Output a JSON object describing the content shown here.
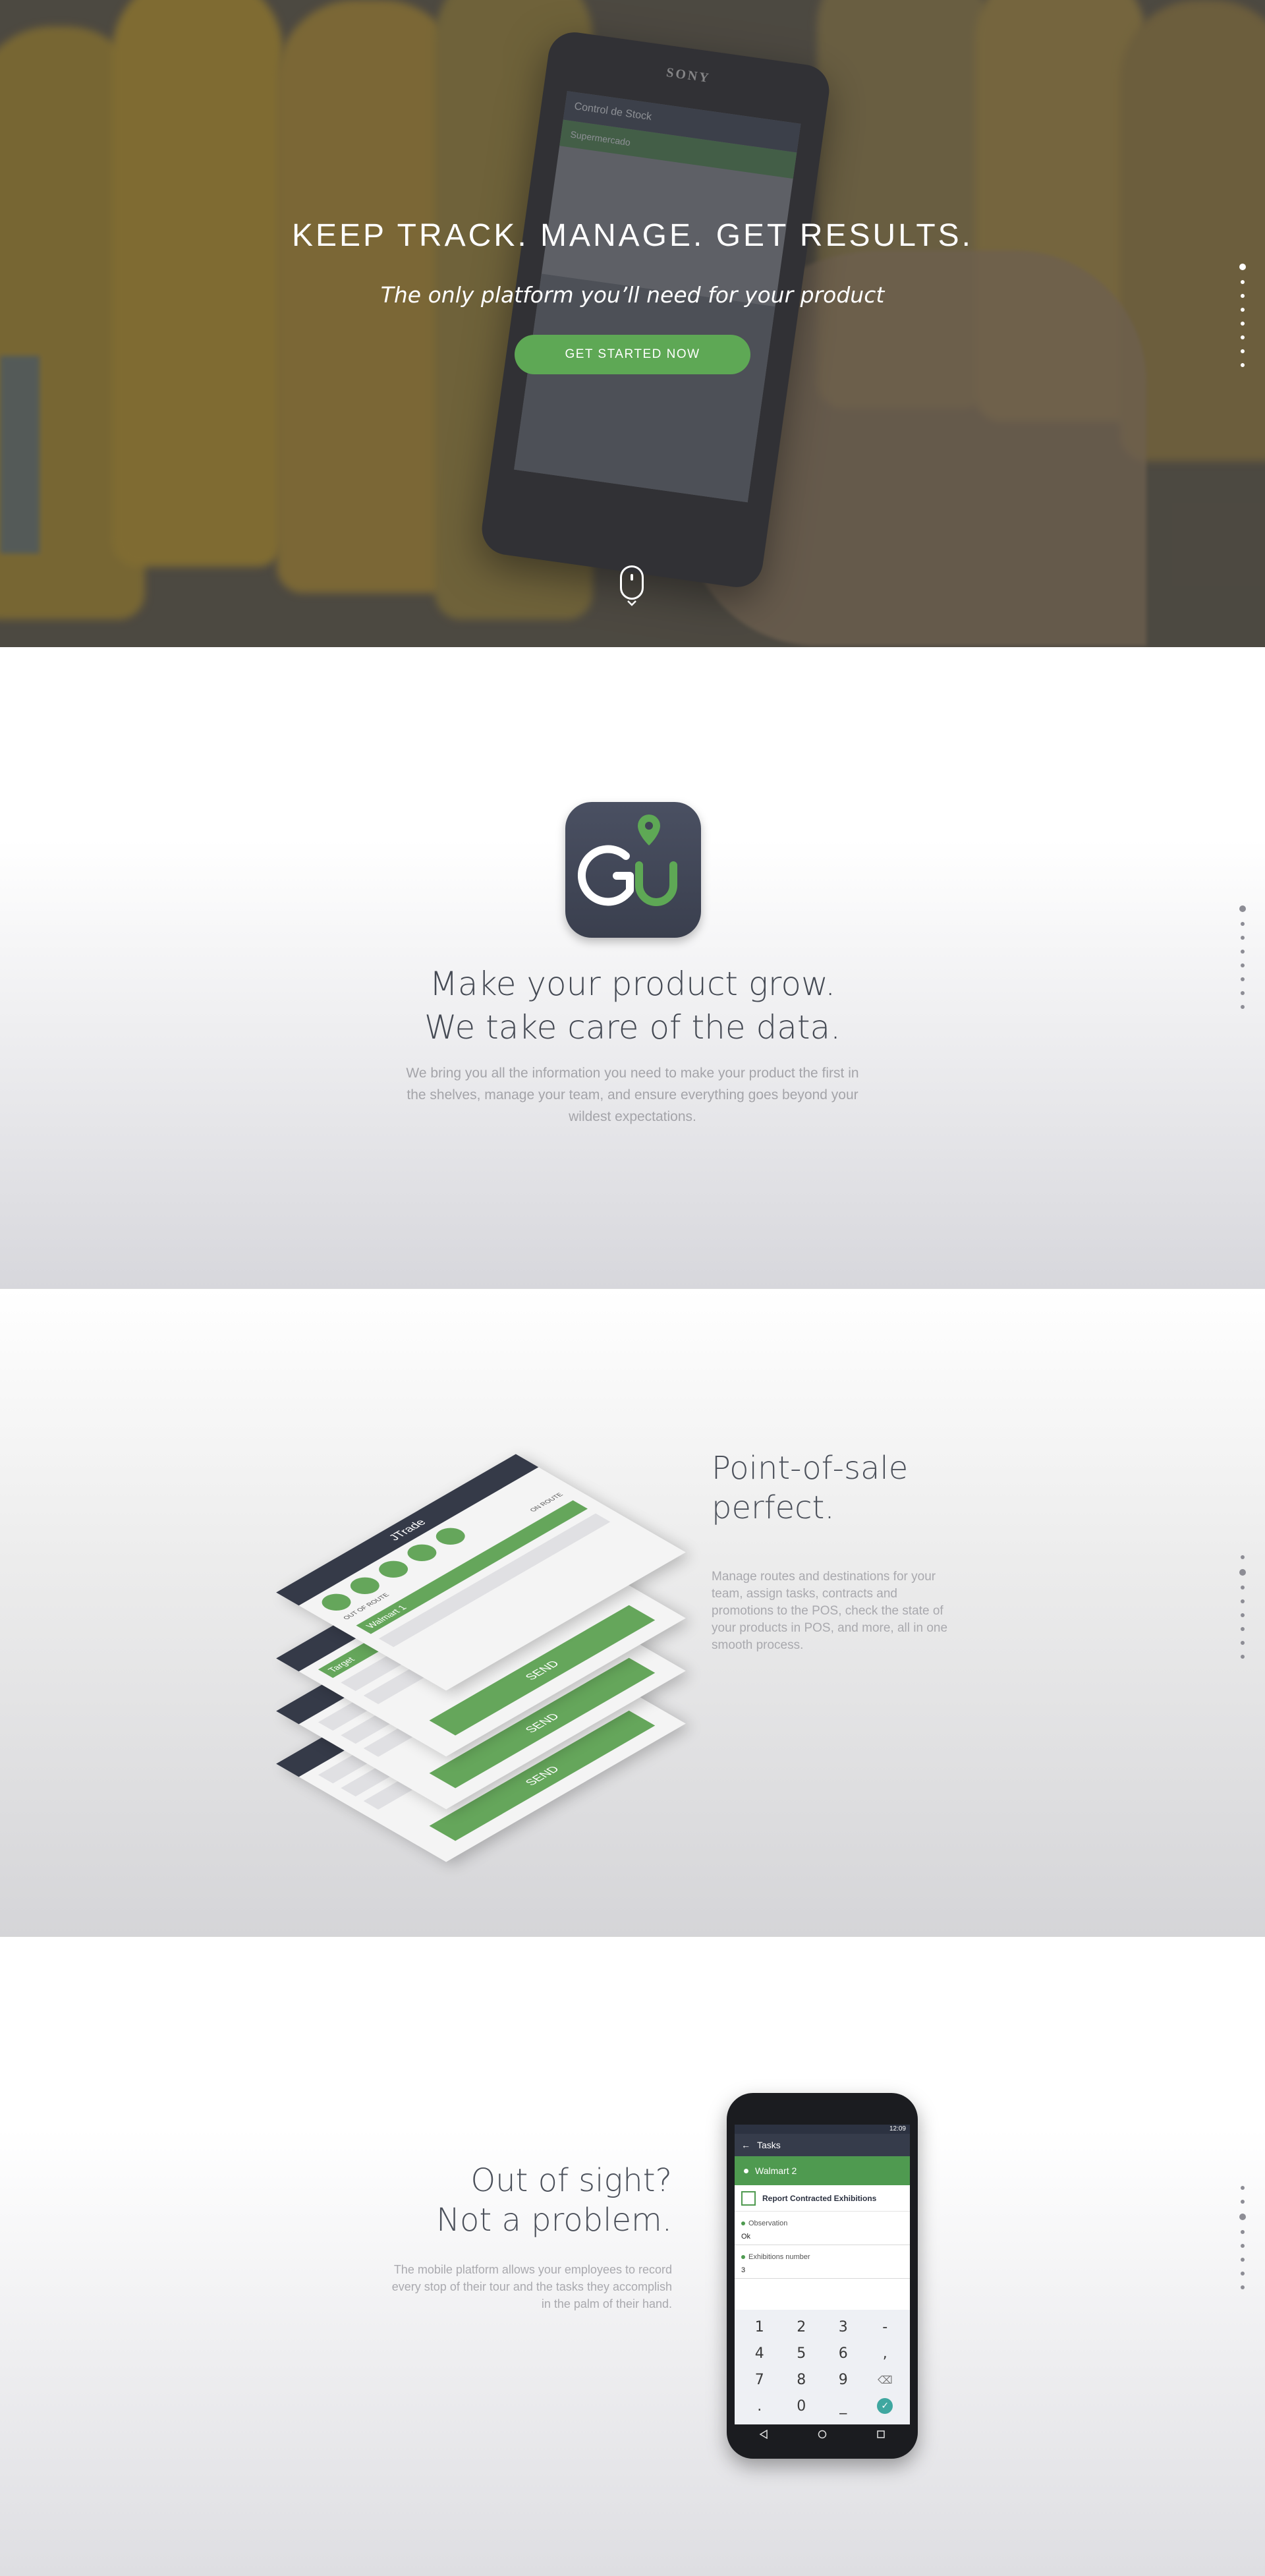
{
  "hero": {
    "title": "KEEP TRACK. MANAGE. GET RESULTS.",
    "subtitle": "The only platform you’ll need for your product",
    "cta_label": "GET STARTED NOW",
    "phone_brand": "SONY",
    "phone_screen_title": "Control de Stock",
    "phone_screen_item": "Supermercado"
  },
  "grow": {
    "title_line1": "Make your product grow.",
    "title_line2": "We take care of the data.",
    "body": "We bring you all the information you need to make your product the first in the shelves, manage your team, and ensure everything goes beyond your wildest expectations."
  },
  "pos": {
    "title_line1": "Point-of-sale",
    "title_line2": "perfect.",
    "body": "Manage routes and destinations for your team, assign tasks, contracts and promotions to the POS, check the state of your products in POS, and more, all in one smooth process.",
    "mockup": {
      "app_name": "JTrade",
      "out_of_route": "OUT OF ROUTE",
      "on_route": "ON ROUTE",
      "store1": "Walmart 1",
      "store2": "Target",
      "send_label": "SEND"
    }
  },
  "sight": {
    "title_line1": "Out of sight?",
    "title_line2": "Not a problem.",
    "body": "The mobile platform allows your employees to record every stop of their tour and the tasks they accomplish in the palm of their hand.",
    "phone": {
      "clock": "12:09",
      "appbar_title": "Tasks",
      "store": "Walmart 2",
      "task_title": "Report Contracted Exhibitions",
      "field1_label": "Observation",
      "field1_value": "Ok",
      "field2_label": "Exhibitions number",
      "field2_value": "3",
      "keys": [
        "1",
        "2",
        "3",
        "-",
        "4",
        "5",
        "6",
        ",",
        "7",
        "8",
        "9",
        "⌫",
        ".",
        "0",
        "_",
        "✓"
      ]
    }
  },
  "colors": {
    "accent_green": "#5ea855",
    "dark_navy": "#363c4b",
    "heading_gray": "#4c515b",
    "body_gray": "#a9a9ae"
  },
  "dot_nav_count": 8
}
